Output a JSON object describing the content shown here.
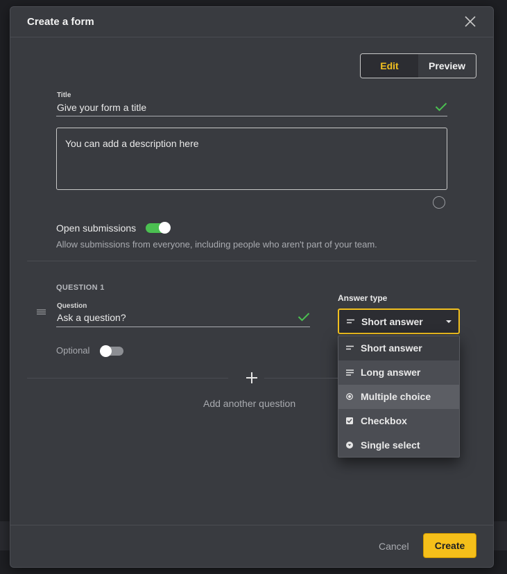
{
  "modal": {
    "title": "Create a form"
  },
  "mode_toggle": {
    "edit_label": "Edit",
    "preview_label": "Preview",
    "active": "Edit"
  },
  "form": {
    "title_label": "Title",
    "title_value": "Give your form a title",
    "description_value": "You can add a description here"
  },
  "submissions": {
    "toggle_label": "Open submissions",
    "enabled": true,
    "help_text": "Allow submissions from everyone, including people who aren't part of your team."
  },
  "question": {
    "heading": "QUESTION 1",
    "field_label": "Question",
    "field_value": "Ask a question?",
    "optional_label": "Optional",
    "optional_enabled": false,
    "answer_type_label": "Answer type",
    "answer_type_selected": "Short answer",
    "answer_type_options": [
      {
        "label": "Short answer",
        "icon": "short-answer-icon"
      },
      {
        "label": "Long answer",
        "icon": "long-answer-icon"
      },
      {
        "label": "Multiple choice",
        "icon": "radio-icon"
      },
      {
        "label": "Checkbox",
        "icon": "checkbox-icon"
      },
      {
        "label": "Single select",
        "icon": "single-select-icon"
      }
    ]
  },
  "add_question": {
    "label": "Add another question"
  },
  "footer": {
    "cancel_label": "Cancel",
    "create_label": "Create"
  },
  "colors": {
    "accent": "#f2c01f",
    "success": "#4bc051",
    "surface": "#393b40"
  }
}
